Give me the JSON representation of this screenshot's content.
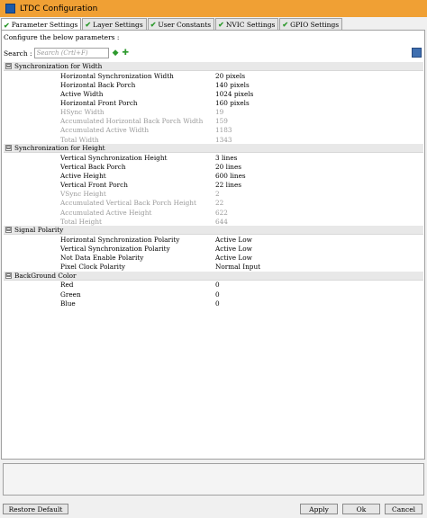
{
  "window": {
    "title": "LTDC Configuration"
  },
  "tabs": [
    {
      "label": "Parameter Settings",
      "active": true
    },
    {
      "label": "Layer Settings",
      "active": false
    },
    {
      "label": "User Constants",
      "active": false
    },
    {
      "label": "NVIC Settings",
      "active": false
    },
    {
      "label": "GPIO Settings",
      "active": false
    }
  ],
  "panel": {
    "subtitle": "Configure the below parameters :"
  },
  "search": {
    "label": "Search :",
    "placeholder": "Search (Crtl+F)"
  },
  "groups": [
    {
      "label": "Synchronization for Width",
      "params": [
        {
          "name": "Horizontal Synchronization Width",
          "value": "20 pixels",
          "readonly": false
        },
        {
          "name": "Horizontal Back Porch",
          "value": "140 pixels",
          "readonly": false
        },
        {
          "name": "Active Width",
          "value": "1024 pixels",
          "readonly": false
        },
        {
          "name": "Horizontal Front Porch",
          "value": "160 pixels",
          "readonly": false
        },
        {
          "name": "HSync Width",
          "value": "19",
          "readonly": true
        },
        {
          "name": "Accumulated Horizontal Back Porch Width",
          "value": "159",
          "readonly": true
        },
        {
          "name": "Accumulated Active Width",
          "value": "1183",
          "readonly": true
        },
        {
          "name": "Total Width",
          "value": "1343",
          "readonly": true
        }
      ]
    },
    {
      "label": "Synchronization for Height",
      "params": [
        {
          "name": "Vertical Synchronization Height",
          "value": "3 lines",
          "readonly": false
        },
        {
          "name": "Vertical Back Porch",
          "value": "20 lines",
          "readonly": false
        },
        {
          "name": "Active Height",
          "value": "600 lines",
          "readonly": false
        },
        {
          "name": "Vertical Front Porch",
          "value": "22 lines",
          "readonly": false
        },
        {
          "name": "VSync Height",
          "value": "2",
          "readonly": true
        },
        {
          "name": "Accumulated Vertical Back Porch Height",
          "value": "22",
          "readonly": true
        },
        {
          "name": "Accumulated Active Height",
          "value": "622",
          "readonly": true
        },
        {
          "name": "Total Height",
          "value": "644",
          "readonly": true
        }
      ]
    },
    {
      "label": "Signal Polarity",
      "params": [
        {
          "name": "Horizontal Synchronization Polarity",
          "value": "Active Low",
          "readonly": false
        },
        {
          "name": "Vertical Synchronization Polarity",
          "value": "Active Low",
          "readonly": false
        },
        {
          "name": "Not Data Enable Polarity",
          "value": "Active Low",
          "readonly": false
        },
        {
          "name": "Pixel Clock Polarity",
          "value": "Normal Input",
          "readonly": false
        }
      ]
    },
    {
      "label": "BackGround Color",
      "params": [
        {
          "name": "Red",
          "value": "0",
          "readonly": false
        },
        {
          "name": "Green",
          "value": "0",
          "readonly": false
        },
        {
          "name": "Blue",
          "value": "0",
          "readonly": false
        }
      ]
    }
  ],
  "collapse_glyph": "⊟",
  "buttons": {
    "restore": "Restore Default",
    "apply": "Apply",
    "ok": "Ok",
    "cancel": "Cancel"
  }
}
